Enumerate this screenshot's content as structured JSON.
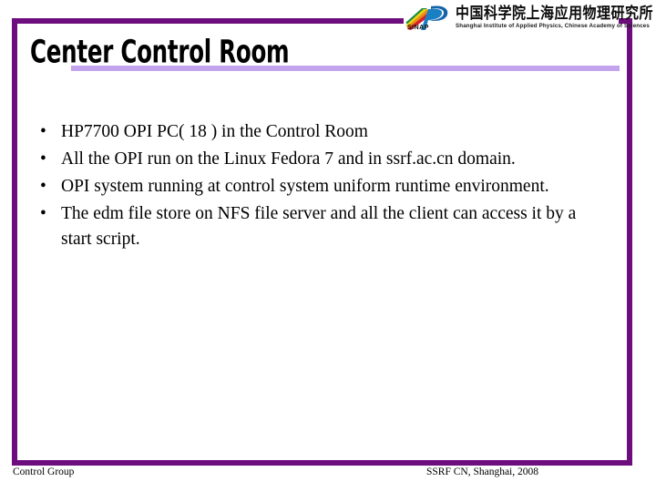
{
  "slide": {
    "title": "Center Control Room",
    "bullet_marker": "•",
    "bullets": [
      "HP7700 OPI PC( 18 ) in the Control Room",
      "All the OPI run on the Linux Fedora 7 and in ssrf.ac.cn domain.",
      "OPI system running at control system uniform runtime environment.",
      "The edm file store on NFS file server and all the client can access it by a start script."
    ]
  },
  "logo": {
    "mark_name": "sinap-rainbow-p-logo",
    "acronym": "SINAP",
    "chinese_name": "中国科学院上海应用物理研究所",
    "english_name": "Shanghai Institute of Applied Physics, Chinese Academy of Sciences"
  },
  "footer": {
    "left": "Control Group",
    "right": "SSRF CN, Shanghai, 2008"
  },
  "colors": {
    "frame_purple": "#6E0D7E",
    "accent_lavender": "#C3A2EE",
    "text_black": "#000000",
    "background": "#FFFFFF"
  }
}
